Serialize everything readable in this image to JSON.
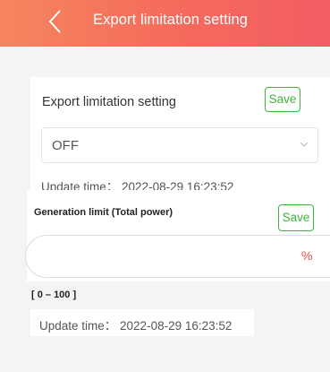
{
  "header": {
    "title": "Export limitation setting",
    "back_icon": "chevron-left-icon"
  },
  "export_limitation": {
    "label": "Export limitation setting",
    "save_label": "Save",
    "selected_value": "OFF",
    "dropdown_icon": "chevron-down-icon",
    "update_time": "Update time： 2022-08-29 16:23:52"
  },
  "generation_limit": {
    "label": "Generation limit (Total power)",
    "save_label": "Save",
    "value": "",
    "unit": "%",
    "range": "[ 0 – 100 ]",
    "update_time": "Update time： 2022-08-29 16:23:52"
  },
  "colors": {
    "header_gradient_start": "#f5855e",
    "header_gradient_end": "#f25c62",
    "save_green": "#3cb53c",
    "unit_red": "#e84848",
    "background": "#f4f4f4"
  }
}
